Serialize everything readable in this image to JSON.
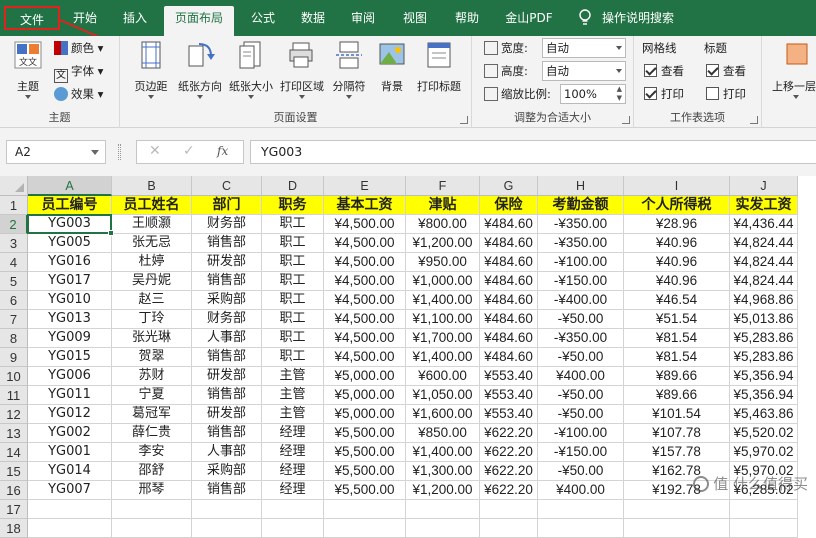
{
  "menu": {
    "tabs": [
      "文件",
      "开始",
      "插入",
      "页面布局",
      "公式",
      "数据",
      "审阅",
      "视图",
      "帮助",
      "金山PDF"
    ],
    "active": "页面布局",
    "search_label": "操作说明搜索"
  },
  "ribbon": {
    "theme": {
      "main": "主题",
      "colors": "颜色",
      "fonts": "字体",
      "effects": "效果",
      "group_label": "主题"
    },
    "page_setup": {
      "margins": "页边距",
      "orientation": "纸张方向",
      "size": "纸张大小",
      "print_area": "打印区域",
      "breaks": "分隔符",
      "background": "背景",
      "print_titles": "打印标题",
      "group_label": "页面设置"
    },
    "scale": {
      "width_label": "宽度:",
      "width_value": "自动",
      "height_label": "高度:",
      "height_value": "自动",
      "scale_label": "缩放比例:",
      "scale_value": "100%",
      "group_label": "调整为合适大小"
    },
    "sheet_options": {
      "gridlines": "网格线",
      "headings": "标题",
      "view": "查看",
      "print": "打印",
      "group_label": "工作表选项"
    },
    "arrange": {
      "bring_forward": "上移一层"
    }
  },
  "formula_bar": {
    "name_box": "A2",
    "formula": "YG003",
    "fx": "fx"
  },
  "columns": [
    "A",
    "B",
    "C",
    "D",
    "E",
    "F",
    "G",
    "H",
    "I",
    "J"
  ],
  "header_row": [
    "员工编号",
    "员工姓名",
    "部门",
    "职务",
    "基本工资",
    "津贴",
    "保险",
    "考勤金额",
    "个人所得税",
    "实发工资"
  ],
  "rows": [
    [
      "YG003",
      "王顺灏",
      "财务部",
      "职工",
      "¥4,500.00",
      "¥800.00",
      "¥484.60",
      "-¥350.00",
      "¥28.96",
      "¥4,436.44"
    ],
    [
      "YG005",
      "张无忌",
      "销售部",
      "职工",
      "¥4,500.00",
      "¥1,200.00",
      "¥484.60",
      "-¥350.00",
      "¥40.96",
      "¥4,824.44"
    ],
    [
      "YG016",
      "杜婷",
      "研发部",
      "职工",
      "¥4,500.00",
      "¥950.00",
      "¥484.60",
      "-¥100.00",
      "¥40.96",
      "¥4,824.44"
    ],
    [
      "YG017",
      "吴丹妮",
      "销售部",
      "职工",
      "¥4,500.00",
      "¥1,000.00",
      "¥484.60",
      "-¥150.00",
      "¥40.96",
      "¥4,824.44"
    ],
    [
      "YG010",
      "赵三",
      "采购部",
      "职工",
      "¥4,500.00",
      "¥1,400.00",
      "¥484.60",
      "-¥400.00",
      "¥46.54",
      "¥4,968.86"
    ],
    [
      "YG013",
      "丁玲",
      "财务部",
      "职工",
      "¥4,500.00",
      "¥1,100.00",
      "¥484.60",
      "-¥50.00",
      "¥51.54",
      "¥5,013.86"
    ],
    [
      "YG009",
      "张光琳",
      "人事部",
      "职工",
      "¥4,500.00",
      "¥1,700.00",
      "¥484.60",
      "-¥350.00",
      "¥81.54",
      "¥5,283.86"
    ],
    [
      "YG015",
      "贺翠",
      "销售部",
      "职工",
      "¥4,500.00",
      "¥1,400.00",
      "¥484.60",
      "-¥50.00",
      "¥81.54",
      "¥5,283.86"
    ],
    [
      "YG006",
      "苏财",
      "研发部",
      "主管",
      "¥5,000.00",
      "¥600.00",
      "¥553.40",
      "¥400.00",
      "¥89.66",
      "¥5,356.94"
    ],
    [
      "YG011",
      "宁夏",
      "销售部",
      "主管",
      "¥5,000.00",
      "¥1,050.00",
      "¥553.40",
      "-¥50.00",
      "¥89.66",
      "¥5,356.94"
    ],
    [
      "YG012",
      "葛冠军",
      "研发部",
      "主管",
      "¥5,000.00",
      "¥1,600.00",
      "¥553.40",
      "-¥50.00",
      "¥101.54",
      "¥5,463.86"
    ],
    [
      "YG002",
      "薛仁贵",
      "销售部",
      "经理",
      "¥5,500.00",
      "¥850.00",
      "¥622.20",
      "-¥100.00",
      "¥107.78",
      "¥5,520.02"
    ],
    [
      "YG001",
      "李安",
      "人事部",
      "经理",
      "¥5,500.00",
      "¥1,400.00",
      "¥622.20",
      "-¥150.00",
      "¥157.78",
      "¥5,970.02"
    ],
    [
      "YG014",
      "邵舒",
      "采购部",
      "经理",
      "¥5,500.00",
      "¥1,300.00",
      "¥622.20",
      "-¥50.00",
      "¥162.78",
      "¥5,970.02"
    ],
    [
      "YG007",
      "邢琴",
      "销售部",
      "经理",
      "¥5,500.00",
      "¥1,200.00",
      "¥622.20",
      "¥400.00",
      "¥192.78",
      "¥6,285.02"
    ]
  ],
  "row_numbers": [
    "1",
    "2",
    "3",
    "4",
    "5",
    "6",
    "7",
    "8",
    "9",
    "10",
    "11",
    "12",
    "13",
    "14",
    "15",
    "16",
    "17",
    "18"
  ],
  "watermark": "值 什么值得买",
  "colors": {
    "excel_green": "#217346",
    "header_fill": "#ffff00",
    "highlight_red": "#e0231c"
  }
}
